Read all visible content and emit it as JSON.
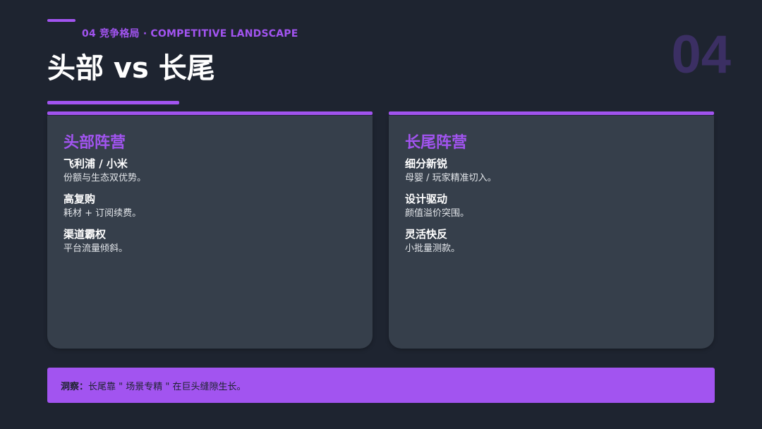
{
  "header": {
    "section_label": "04 竞争格局 · COMPETITIVE LANDSCAPE",
    "title": "头部 vs 长尾",
    "page_number": "04"
  },
  "cards": [
    {
      "title": "头部阵营",
      "items": [
        {
          "title": "飞利浦 / 小米",
          "desc": "份额与生态双优势。"
        },
        {
          "title": "高复购",
          "desc": "耗材 + 订阅续费。"
        },
        {
          "title": "渠道霸权",
          "desc": "平台流量倾斜。"
        }
      ]
    },
    {
      "title": "长尾阵营",
      "items": [
        {
          "title": "细分新锐",
          "desc": "母婴 / 玩家精准切入。"
        },
        {
          "title": "设计驱动",
          "desc": "颜值溢价突围。"
        },
        {
          "title": "灵活快反",
          "desc": "小批量测款。"
        }
      ]
    }
  ],
  "insight": {
    "label": "洞察：",
    "text": "长尾靠 \" 场景专精 \" 在巨头缝隙生长。"
  },
  "colors": {
    "accent": "#a254f0",
    "background": "#1e2430",
    "card": "#363f4b",
    "page_number": "#3b2f63"
  }
}
